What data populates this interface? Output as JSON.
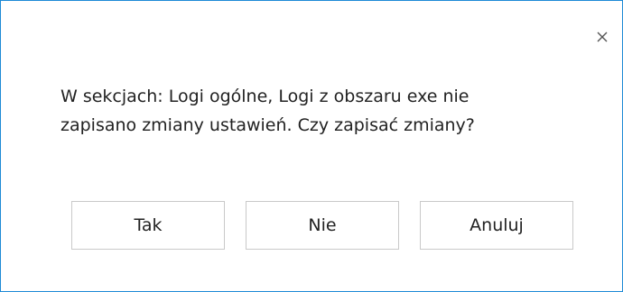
{
  "dialog": {
    "close_icon": "close-icon",
    "message_lines": [
      "W sekcjach: Logi ogólne, Logi z obszaru exe nie",
      "zapisano zmiany ustawień. Czy zapisać zmiany?"
    ],
    "buttons": {
      "yes_label": "Tak",
      "no_label": "Nie",
      "cancel_label": "Anuluj"
    }
  },
  "colors": {
    "border_accent": "#1e8ad6",
    "button_border": "#c9c9c9",
    "text": "#222222"
  }
}
